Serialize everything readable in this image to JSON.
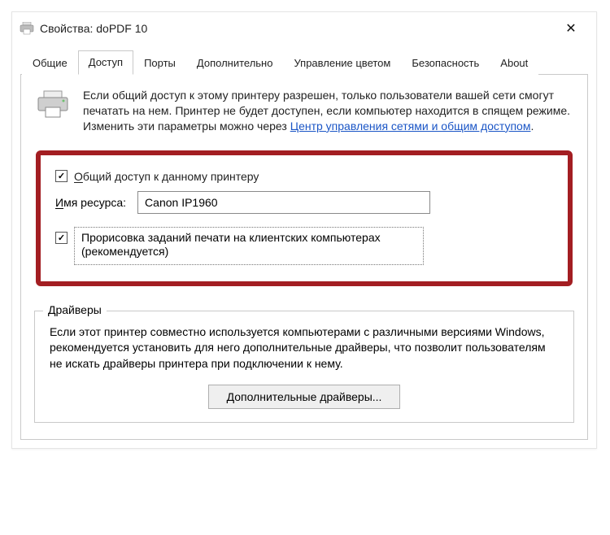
{
  "titlebar": {
    "title": "Свойства: doPDF 10"
  },
  "tabs": {
    "t0": "Общие",
    "t1": "Доступ",
    "t2": "Порты",
    "t3": "Дополнительно",
    "t4": "Управление цветом",
    "t5": "Безопасность",
    "t6": "About",
    "active": "t1"
  },
  "info": {
    "text_before_link": "Если общий доступ к этому принтеру разрешен, только пользователи вашей сети смогут печатать на нем. Принтер не будет доступен, если компьютер находится в спящем режиме. Изменить эти параметры можно через ",
    "link": "Центр управления сетями и общим доступом",
    "text_after_link": "."
  },
  "sharing": {
    "share_checked": true,
    "share_mnemonic": "О",
    "share_rest": "бщий доступ к данному принтеру",
    "name_label_mnemonic": "И",
    "name_label_rest": "мя ресурса:",
    "share_name": "Canon IP1960",
    "render_checked": true,
    "render_label": "Прорисовка заданий печати на клиентских компьютерах (рекомендуется)"
  },
  "drivers": {
    "legend": "Драйверы",
    "text": "Если этот принтер совместно используется компьютерами с различными версиями Windows, рекомендуется установить для него дополнительные драйверы, что позволит пользователям не искать драйверы принтера при подключении к нему.",
    "button": "Дополнительные драйверы..."
  }
}
